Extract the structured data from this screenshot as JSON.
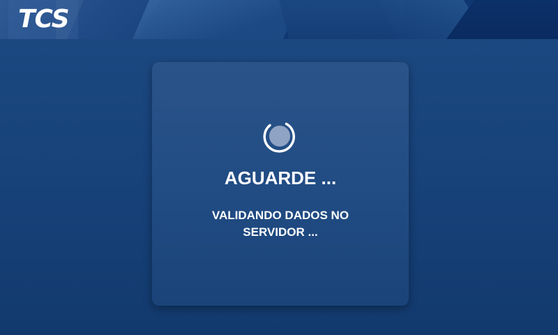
{
  "header": {
    "logo_text": "TCS",
    "background_color": "#0f3873"
  },
  "dialog": {
    "spinner_icon": "loading-spinner-icon",
    "title": "AGUARDE ...",
    "message": "VALIDANDO DADOS NO SERVIDOR ..."
  },
  "colors": {
    "page_background": "#17427a",
    "card_background": "#214c84",
    "text": "#ffffff",
    "spinner_ring": "#ffffff",
    "spinner_fill": "#8fa3c4"
  }
}
